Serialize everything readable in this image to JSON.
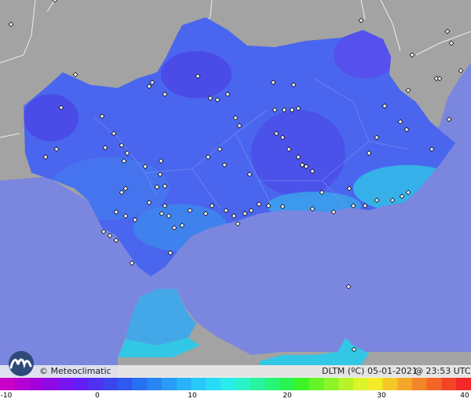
{
  "credit": "© Meteoclimatic",
  "variable": "DLTM (ºC)",
  "date": "05-01-2021",
  "time": "@ 23:53 UTC",
  "icons": {
    "logo": "meteoclimatic-wave-logo",
    "station": "station-marker-icon"
  },
  "colors": {
    "sea": "#7b86df",
    "land_outside": "#a3a3a3",
    "interior_main": "#4a66ee",
    "interior_cold": "#4b4be8",
    "coast_warm": "#33c7e6",
    "africa": "#44a8e8"
  },
  "scale": {
    "min": -10,
    "max": 40,
    "tick_values": [
      -10,
      0,
      10,
      20,
      30,
      40
    ],
    "tick_labels": [
      "-10",
      "0",
      "10",
      "20",
      "30",
      "40"
    ],
    "colors": [
      "#c800c8",
      "#b400d2",
      "#a000dc",
      "#8c0ae6",
      "#7814f0",
      "#641efa",
      "#5032f0",
      "#3c46ec",
      "#2e5af0",
      "#2870f2",
      "#2886f4",
      "#289cf6",
      "#28b2f8",
      "#28c8fa",
      "#28dcf8",
      "#28ecea",
      "#28f4c8",
      "#28f4a0",
      "#28f478",
      "#28f450",
      "#3cf428",
      "#64f428",
      "#8cf428",
      "#b4f428",
      "#dcf428",
      "#f4ea28",
      "#f4c828",
      "#f4a628",
      "#f48428",
      "#f46428",
      "#f44428",
      "#f42828"
    ]
  }
}
